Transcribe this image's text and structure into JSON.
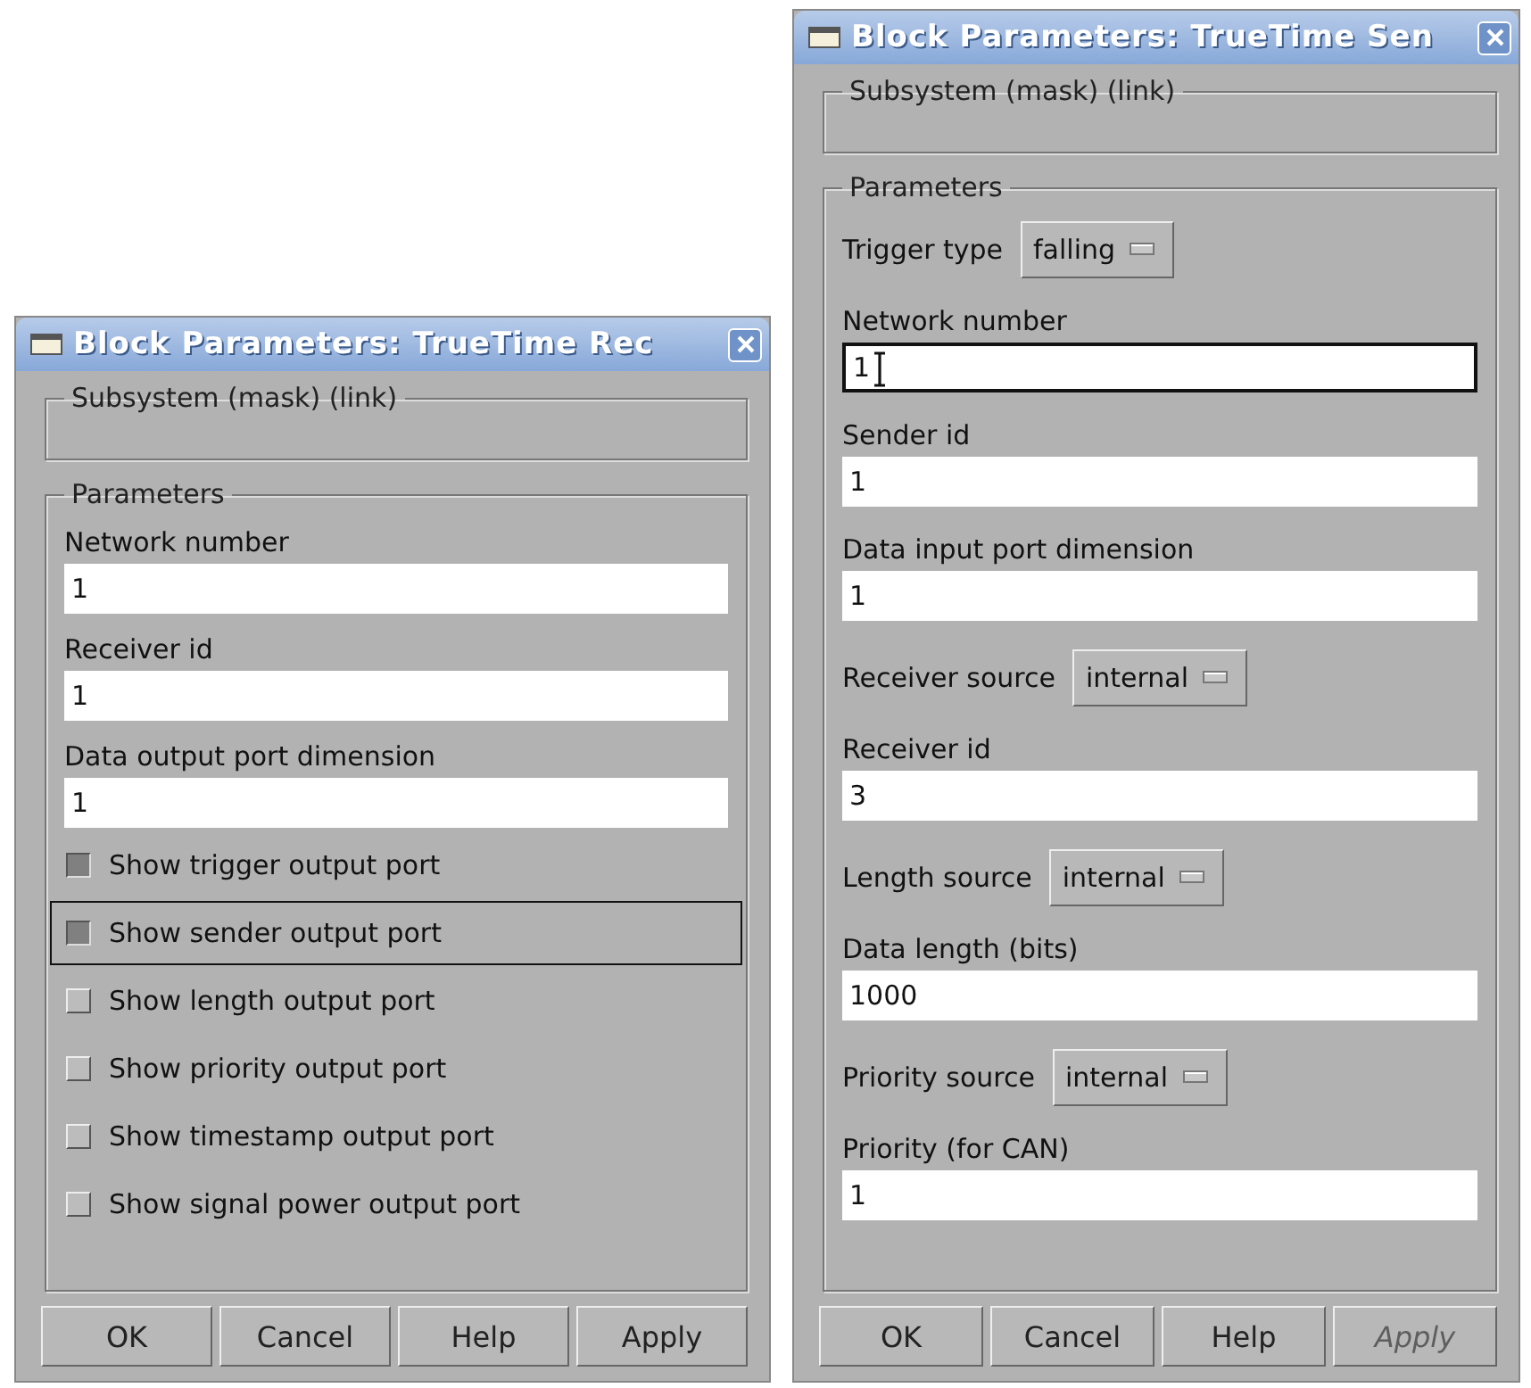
{
  "windows": [
    {
      "title": "Block Parameters: TrueTime Rec",
      "subsystem": "Subsystem (mask) (link)",
      "parameters_label": "Parameters",
      "items": [
        {
          "kind": "field",
          "label": "Network number",
          "value": "1",
          "focused": false
        },
        {
          "kind": "field",
          "label": "Receiver id",
          "value": "1",
          "focused": false
        },
        {
          "kind": "field",
          "label": "Data output port dimension",
          "value": "1",
          "focused": false
        },
        {
          "kind": "checkbox",
          "label": "Show trigger output port",
          "checked": true,
          "focused": false
        },
        {
          "kind": "checkbox",
          "label": "Show sender output port",
          "checked": true,
          "focused": true
        },
        {
          "kind": "checkbox",
          "label": "Show length output port",
          "checked": false,
          "focused": false
        },
        {
          "kind": "checkbox",
          "label": "Show priority output port",
          "checked": false,
          "focused": false
        },
        {
          "kind": "checkbox",
          "label": "Show timestamp output port",
          "checked": false,
          "focused": false
        },
        {
          "kind": "checkbox",
          "label": "Show signal power output port",
          "checked": false,
          "focused": false
        }
      ],
      "buttons": [
        {
          "label": "OK",
          "disabled": false
        },
        {
          "label": "Cancel",
          "disabled": false
        },
        {
          "label": "Help",
          "disabled": false
        },
        {
          "label": "Apply",
          "disabled": false
        }
      ]
    },
    {
      "title": "Block Parameters: TrueTime Sen",
      "subsystem": "Subsystem (mask) (link)",
      "parameters_label": "Parameters",
      "items": [
        {
          "kind": "dropdown",
          "label": "Trigger type",
          "value": "falling"
        },
        {
          "kind": "field",
          "label": "Network number",
          "value": "1",
          "focused": true
        },
        {
          "kind": "field",
          "label": "Sender id",
          "value": "1",
          "focused": false
        },
        {
          "kind": "field",
          "label": "Data input port dimension",
          "value": "1",
          "focused": false
        },
        {
          "kind": "dropdown",
          "label": "Receiver source",
          "value": "internal"
        },
        {
          "kind": "field",
          "label": "Receiver id",
          "value": "3",
          "focused": false
        },
        {
          "kind": "dropdown",
          "label": "Length source",
          "value": "internal"
        },
        {
          "kind": "field",
          "label": "Data length (bits)",
          "value": "1000",
          "focused": false
        },
        {
          "kind": "dropdown",
          "label": "Priority source",
          "value": "internal"
        },
        {
          "kind": "field",
          "label": "Priority (for CAN)",
          "value": "1",
          "focused": false
        }
      ],
      "buttons": [
        {
          "label": "OK",
          "disabled": false
        },
        {
          "label": "Cancel",
          "disabled": false
        },
        {
          "label": "Help",
          "disabled": false
        },
        {
          "label": "Apply",
          "disabled": true
        }
      ]
    }
  ]
}
